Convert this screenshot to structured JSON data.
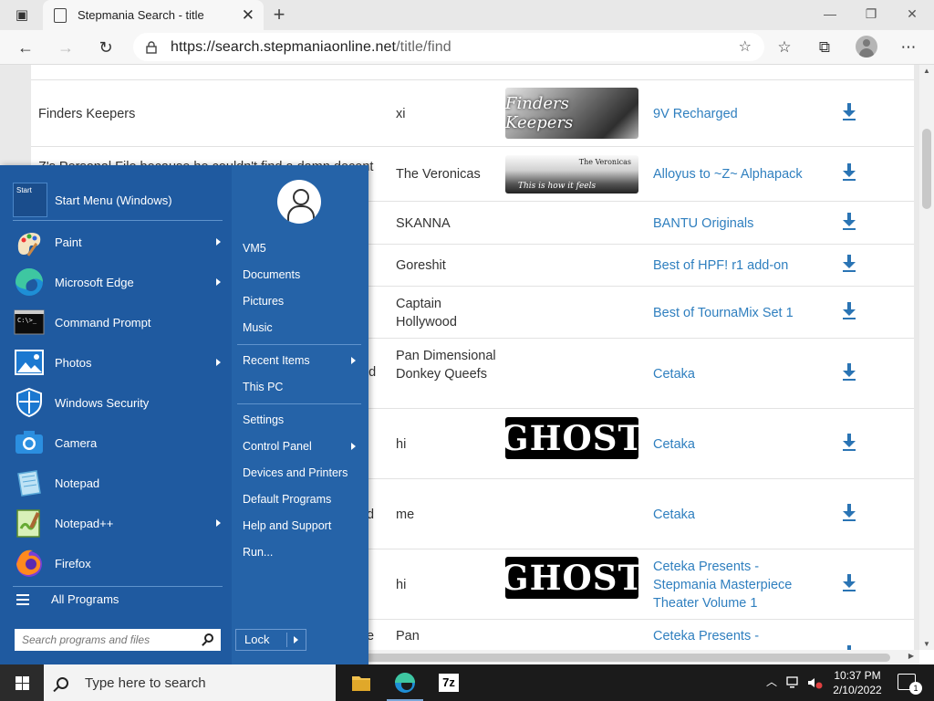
{
  "browser": {
    "tab_title": "Stepmania Search - title",
    "url_host": "https://search.stepmaniaonline.net",
    "url_path": "/title/find",
    "new_tab": "+",
    "close_tab": "✕",
    "minimize": "—",
    "restore": "❐",
    "close": "✕",
    "back": "←",
    "forward": "→",
    "refresh": "↻",
    "add_favorite": "☆",
    "favorites": "☆",
    "collections": "⧉",
    "more": "⋯"
  },
  "rows": [
    {
      "title": "",
      "artist": "",
      "banner": "green",
      "banner_text": "",
      "pack": ""
    },
    {
      "title": "Finders Keepers",
      "artist": "xi",
      "banner": "fk",
      "banner_text": "Finders Keepers",
      "pack": "9V Recharged"
    },
    {
      "title": "Z's Personal File because he couldn't find a damn decent Z",
      "artist": "The Veronicas",
      "banner": "ver",
      "banner_text": "This is how it feels",
      "banner_sub": "The Veronicas",
      "pack": "Alloyus to ~Z~ Alphapack"
    },
    {
      "title": "",
      "artist": "SKANNA",
      "banner": "",
      "pack": "BANTU Originals"
    },
    {
      "title": "",
      "artist": "Goreshit",
      "banner": "",
      "pack": "Best of HPF! r1 add-on"
    },
    {
      "title": "",
      "artist": "Captain Hollywood",
      "banner": "",
      "pack": "Best of TournaMix Set 1"
    },
    {
      "title": "e nd",
      "artist": "Pan Dimensional Donkey Queefs",
      "banner": "",
      "pack": "Cetaka"
    },
    {
      "title": "",
      "artist": "hi",
      "banner": "ghost",
      "banner_text": "GHOST",
      "pack": "Cetaka"
    },
    {
      "title": "d",
      "artist": "me",
      "banner": "",
      "pack": "Cetaka"
    },
    {
      "title": "",
      "artist": "hi",
      "banner": "ghost",
      "banner_text": "GHOST",
      "pack": "Ceteka Presents - Stepmania Masterpiece Theater Volume 1"
    },
    {
      "title": "e",
      "artist": "Pan",
      "banner": "",
      "pack": "Ceteka Presents -"
    }
  ],
  "start_menu": {
    "header": "Start Menu (Windows)",
    "logo_text": "Start",
    "items": [
      {
        "label": "Paint",
        "arrow": true
      },
      {
        "label": "Microsoft Edge",
        "arrow": true
      },
      {
        "label": "Command Prompt",
        "arrow": false
      },
      {
        "label": "Photos",
        "arrow": true
      },
      {
        "label": "Windows Security",
        "arrow": false
      },
      {
        "label": "Camera",
        "arrow": false
      },
      {
        "label": "Notepad",
        "arrow": false
      },
      {
        "label": "Notepad++",
        "arrow": true
      },
      {
        "label": "Firefox",
        "arrow": false
      }
    ],
    "all_programs": "All Programs",
    "search_placeholder": "Search programs and files",
    "right_items": [
      {
        "label": "VM5"
      },
      {
        "label": "Documents"
      },
      {
        "label": "Pictures"
      },
      {
        "label": "Music"
      },
      {
        "label": "Recent Items",
        "arrow": true
      },
      {
        "label": "This PC"
      },
      {
        "label": "Settings"
      },
      {
        "label": "Control Panel",
        "arrow": true
      },
      {
        "label": "Devices and Printers"
      },
      {
        "label": "Default Programs"
      },
      {
        "label": "Help and Support"
      },
      {
        "label": "Run..."
      }
    ],
    "lock": "Lock"
  },
  "taskbar": {
    "search": "Type here to search",
    "time": "10:37 PM",
    "date": "2/10/2022",
    "notifications": "1",
    "zip_label": "7z"
  },
  "colors": {
    "link": "#2f7fbf",
    "start_menu": "#2563a8",
    "download": "#2a74b4"
  }
}
